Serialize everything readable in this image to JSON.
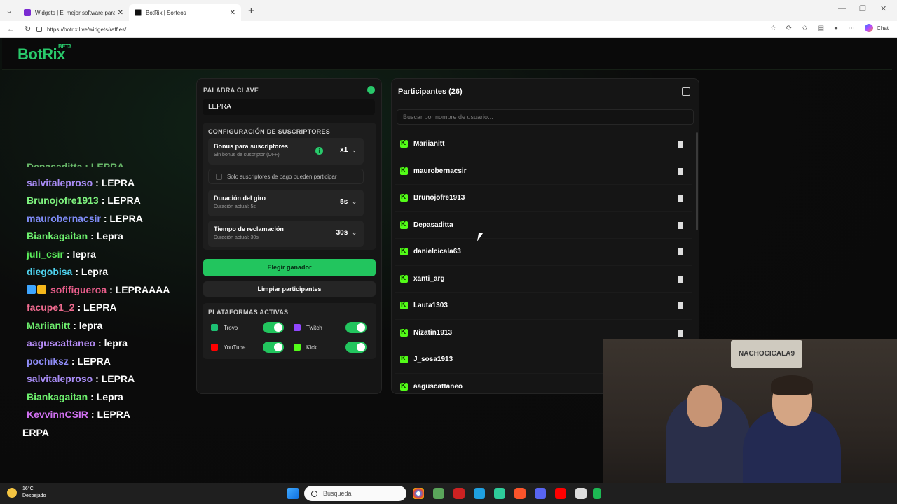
{
  "browser": {
    "tabs": [
      {
        "title": "Widgets | El mejor software para p",
        "favicon_color": "#7a2bd1"
      },
      {
        "title": "BotRix | Sorteos",
        "favicon_color": "#111111"
      }
    ],
    "url": "https://botrix.live/widgets/raffles/",
    "chat_label": "Chat"
  },
  "app": {
    "logo": "BotRix",
    "logo_badge": "BETA",
    "accent": "#29c96b"
  },
  "chat_lines": [
    {
      "user": "salvitaleproso",
      "msg": ": LEPRA",
      "color": "#a88cf5"
    },
    {
      "user": "Brunojofre1913",
      "msg": ": LEPRA",
      "color": "#7ef27e"
    },
    {
      "user": "maurobernacsir",
      "msg": ": LEPRA",
      "color": "#7f8cf7"
    },
    {
      "user": "Biankagaitan",
      "msg": ": Lepra",
      "color": "#6ef06e"
    },
    {
      "user": "juli_csir",
      "msg": ": lepra",
      "color": "#5bee5b"
    },
    {
      "user": "diegobisa",
      "msg": ": Lepra",
      "color": "#4fd4f0"
    },
    {
      "user": "sofifigueroa",
      "msg": ": LEPRAAAA",
      "color": "#e85d8a",
      "badges": true
    },
    {
      "user": "facupe1_2",
      "msg": ": LEPRA",
      "color": "#f06b8f"
    },
    {
      "user": "Mariianitt",
      "msg": ": lepra",
      "color": "#6ef06e"
    },
    {
      "user": "aaguscattaneo",
      "msg": ": lepra",
      "color": "#b58cf5"
    },
    {
      "user": "pochiksz",
      "msg": ": LEPRA",
      "color": "#8f8cf7"
    },
    {
      "user": "salvitaleproso",
      "msg": ": LEPRA",
      "color": "#a88cf5"
    },
    {
      "user": "Biankagaitan",
      "msg": ": Lepra",
      "color": "#6ef06e"
    },
    {
      "user": "KevvinnCSIR",
      "msg": ": LEPRA",
      "color": "#d070f0"
    },
    {
      "user": "",
      "msg": "ERPA",
      "color": "#ffffff"
    }
  ],
  "chat_cut_text": "Depasaditta : LEPRA",
  "settings": {
    "keyword_label": "PALABRA CLAVE",
    "keyword_value": "LEPRA",
    "subs_title": "CONFIGURACIÓN DE SUSCRIPTORES",
    "bonus_title": "Bonus para suscriptores",
    "bonus_desc": "Sin bonus de suscriptor (OFF)",
    "bonus_value": "x1",
    "paid_only_label": "Solo suscriptores de pago pueden participar",
    "spin_title": "Duración del giro",
    "spin_desc": "Duración actual: 5s",
    "spin_value": "5s",
    "claim_title": "Tiempo de reclamación",
    "claim_desc": "Duración actual: 30s",
    "claim_value": "30s",
    "pick_winner": "Elegir ganador",
    "clear_participants": "Limpiar participantes",
    "platforms_title": "PLATAFORMAS ACTIVAS",
    "platforms": [
      {
        "name": "Trovo",
        "color": "#1dbf73",
        "enabled": true
      },
      {
        "name": "Twitch",
        "color": "#9146ff",
        "enabled": true
      },
      {
        "name": "YouTube",
        "color": "#ff0000",
        "enabled": true
      },
      {
        "name": "Kick",
        "color": "#53fc18",
        "enabled": true
      }
    ]
  },
  "participants": {
    "title": "Participantes (26)",
    "search_placeholder": "Buscar por nombre de usuario...",
    "list": [
      "Mariianitt",
      "maurobernacsir",
      "Brunojofre1913",
      "Depasaditta",
      "danielcicala63",
      "xanti_arg",
      "Lauta1303",
      "Nizatin1913",
      "J_sosa1913",
      "aaguscattaneo"
    ]
  },
  "webcam": {
    "sign_text": "NACHOCICALA9"
  },
  "taskbar": {
    "temp": "16°C",
    "weather": "Despejado",
    "search_placeholder": "Búsqueda"
  }
}
